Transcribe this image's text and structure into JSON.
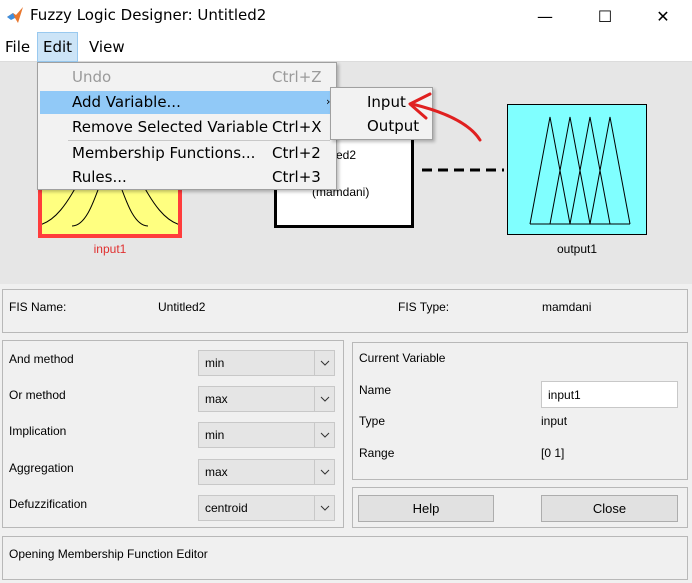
{
  "window": {
    "title": "Fuzzy Logic Designer: Untitled2",
    "controls": {
      "minimize": "—",
      "maximize": "☐",
      "close": "✕"
    }
  },
  "menubar": {
    "file": "File",
    "edit": "Edit",
    "view": "View"
  },
  "edit_menu": {
    "items": [
      {
        "label": "Undo",
        "shortcut": "Ctrl+Z",
        "enabled": false
      },
      {
        "label": "Add Variable...",
        "shortcut": "",
        "submenu_arrow": "›",
        "highlighted": true
      },
      {
        "label": "Remove Selected Variable",
        "shortcut": "Ctrl+X"
      },
      {
        "label": "Membership Functions...",
        "shortcut": "Ctrl+2"
      },
      {
        "label": "Rules...",
        "shortcut": "Ctrl+3"
      }
    ],
    "submenu": [
      "Input",
      "Output"
    ]
  },
  "diagram": {
    "input_label": "input1",
    "output_label": "output1",
    "fis_name_partial": "tled2",
    "fis_type_partial": "(mamdani)",
    "colors": {
      "input_fill": "#ffff80",
      "input_border": "#ff3c3c",
      "output_fill": "#80ffff",
      "annotation": "#e02020"
    }
  },
  "fis_info": {
    "name_label": "FIS Name:",
    "name_value": "Untitled2",
    "type_label": "FIS Type:",
    "type_value": "mamdani"
  },
  "methods": [
    {
      "label": "And method",
      "value": "min"
    },
    {
      "label": "Or method",
      "value": "max"
    },
    {
      "label": "Implication",
      "value": "min"
    },
    {
      "label": "Aggregation",
      "value": "max"
    },
    {
      "label": "Defuzzification",
      "value": "centroid"
    }
  ],
  "current_variable": {
    "title": "Current Variable",
    "name_label": "Name",
    "name_value": "input1",
    "type_label": "Type",
    "type_value": "input",
    "range_label": "Range",
    "range_value": "[0 1]"
  },
  "buttons": {
    "help": "Help",
    "close": "Close"
  },
  "status": "Opening Membership Function Editor"
}
